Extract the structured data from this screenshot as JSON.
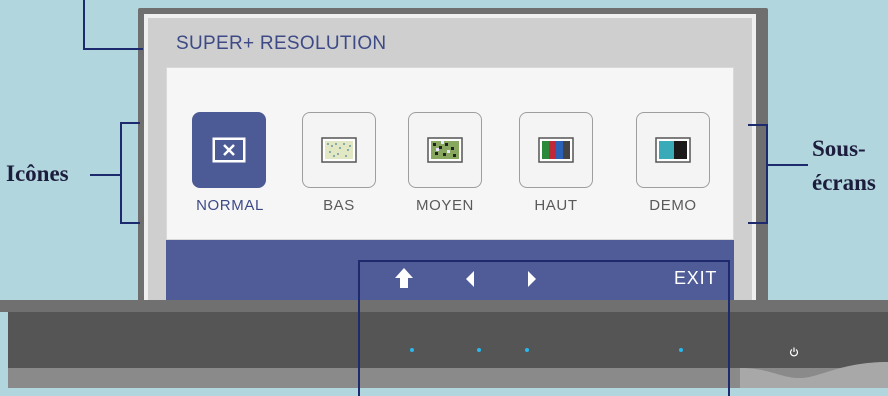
{
  "osd": {
    "title": "SUPER+ RESOLUTION",
    "modes": [
      {
        "label": "NORMAL",
        "selected": true
      },
      {
        "label": "BAS",
        "selected": false
      },
      {
        "label": "MOYEN",
        "selected": false
      },
      {
        "label": "HAUT",
        "selected": false
      },
      {
        "label": "DEMO",
        "selected": false
      }
    ],
    "bar": {
      "exit_label": "EXIT"
    }
  },
  "callouts": {
    "left": "Icônes",
    "right_line1": "Sous-",
    "right_line2": "écrans"
  },
  "colors": {
    "background": "#b2d6de",
    "osd_accent": "#4c5a95",
    "callout_lines": "#1d2b6e",
    "led": "#29b8ee"
  }
}
